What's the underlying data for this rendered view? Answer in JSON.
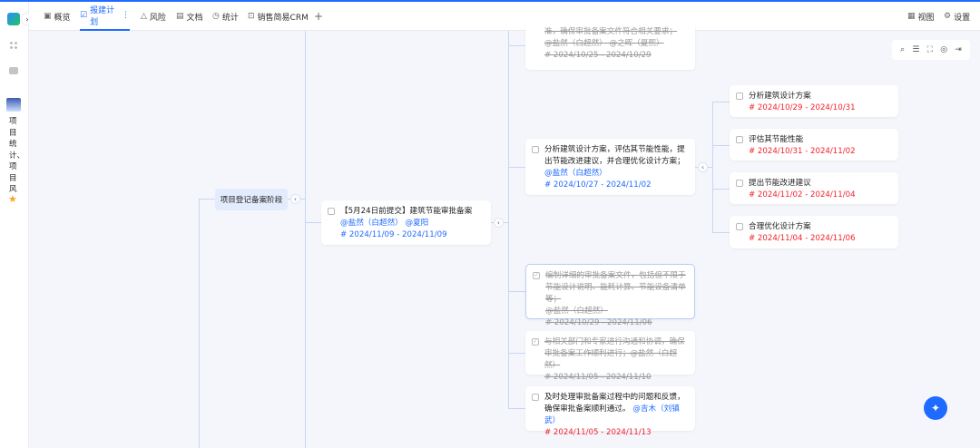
{
  "tabs": [
    {
      "label": "概览",
      "icon": "overview-icon"
    },
    {
      "label": "报建计划",
      "icon": "check-square-icon",
      "active": true
    },
    {
      "label": "风险",
      "icon": "warning-icon"
    },
    {
      "label": "文档",
      "icon": "document-icon"
    },
    {
      "label": "统计",
      "icon": "clock-icon"
    },
    {
      "label": "销售简易CRM",
      "icon": "app-icon"
    }
  ],
  "header_right": {
    "view": "视图",
    "settings": "设置"
  },
  "sidebar": {
    "project_label": "项目统计、项目风"
  },
  "mindmap": {
    "root": "项目登记备案阶段",
    "main": {
      "title": "【5月24日前提交】建筑节能审批备案",
      "assignees": "@盐然（白超然） @夏阳",
      "date": "# 2024/11/09 - 2024/11/09"
    },
    "tasks": [
      {
        "text": "准，确保审批备案文件符合相关要求；",
        "assignees": "@盐然（白超然） @之晖（夏熙）",
        "date": "# 2024/10/25 - 2024/10/29",
        "done": true
      },
      {
        "text": "分析建筑设计方案，评估其节能性能，提出节能改进建议，并合理优化设计方案；",
        "assignees": "@盐然（白超然）",
        "date": "# 2024/10/27 - 2024/11/02",
        "done": false
      },
      {
        "text": "编制详细的审批备案文件，包括但不限于节能设计说明、能耗计算、节能设备清单等；",
        "assignees": "@盐然（白超然）",
        "date": "# 2024/10/29 - 2024/11/06",
        "done": true
      },
      {
        "text": "与相关部门和专家进行沟通和协调，确保审批备案工作顺利进行；",
        "assignees": "@盐然（白超然）",
        "date": "# 2024/11/05 - 2024/11/10",
        "done": true
      },
      {
        "text": "及时处理审批备案过程中的问题和反馈，确保审批备案顺利通过。",
        "assignees": "@吉木（刘镇武）",
        "date": "# 2024/11/05 - 2024/11/13",
        "done": false
      }
    ],
    "subtasks": [
      {
        "text": "分析建筑设计方案",
        "date": "# 2024/10/29 - 2024/10/31"
      },
      {
        "text": "评估其节能性能",
        "date": "# 2024/10/31 - 2024/11/02"
      },
      {
        "text": "提出节能改进建议",
        "date": "# 2024/11/02 - 2024/11/04"
      },
      {
        "text": "合理优化设计方案",
        "date": "# 2024/11/04 - 2024/11/06"
      }
    ]
  }
}
